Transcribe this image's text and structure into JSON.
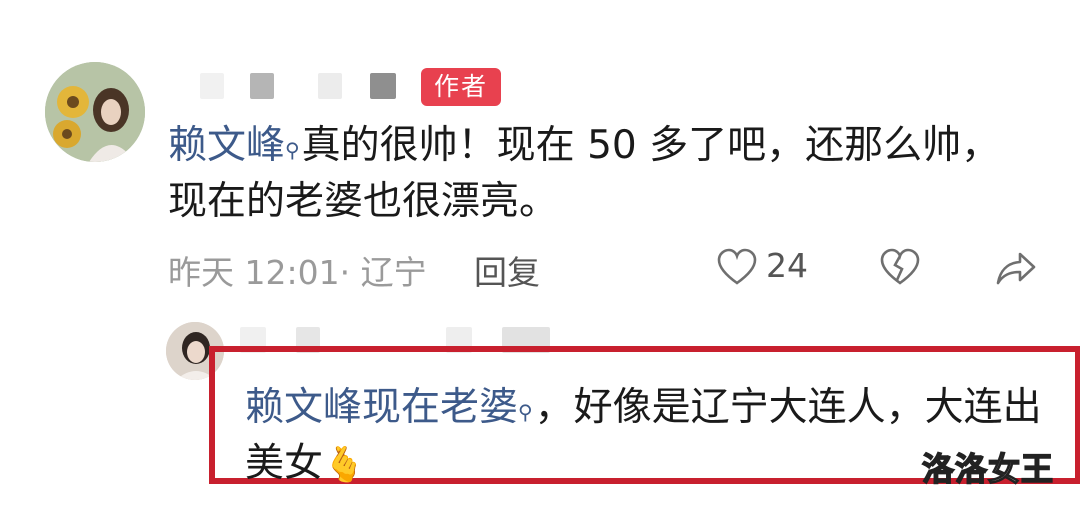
{
  "comment": {
    "author_badge": "作者",
    "mention": "赖文峰",
    "text": "真的很帅！现在 50 多了吧，还那么帅，现在的老婆也很漂亮。",
    "time_location": "昨天 12:01· 辽宁",
    "reply_label": "回复",
    "like_count": "24",
    "icons": [
      "heart-icon",
      "broken-heart-icon",
      "share-icon"
    ]
  },
  "reply": {
    "mention": "赖文峰现在老婆",
    "text": "，好像是辽宁大连人，大连出美女",
    "emoji": "🫰"
  },
  "watermark": "洛洛女王",
  "colors": {
    "badge": "#e8414f",
    "link": "#3d5a8a",
    "highlight": "#c8202e"
  }
}
